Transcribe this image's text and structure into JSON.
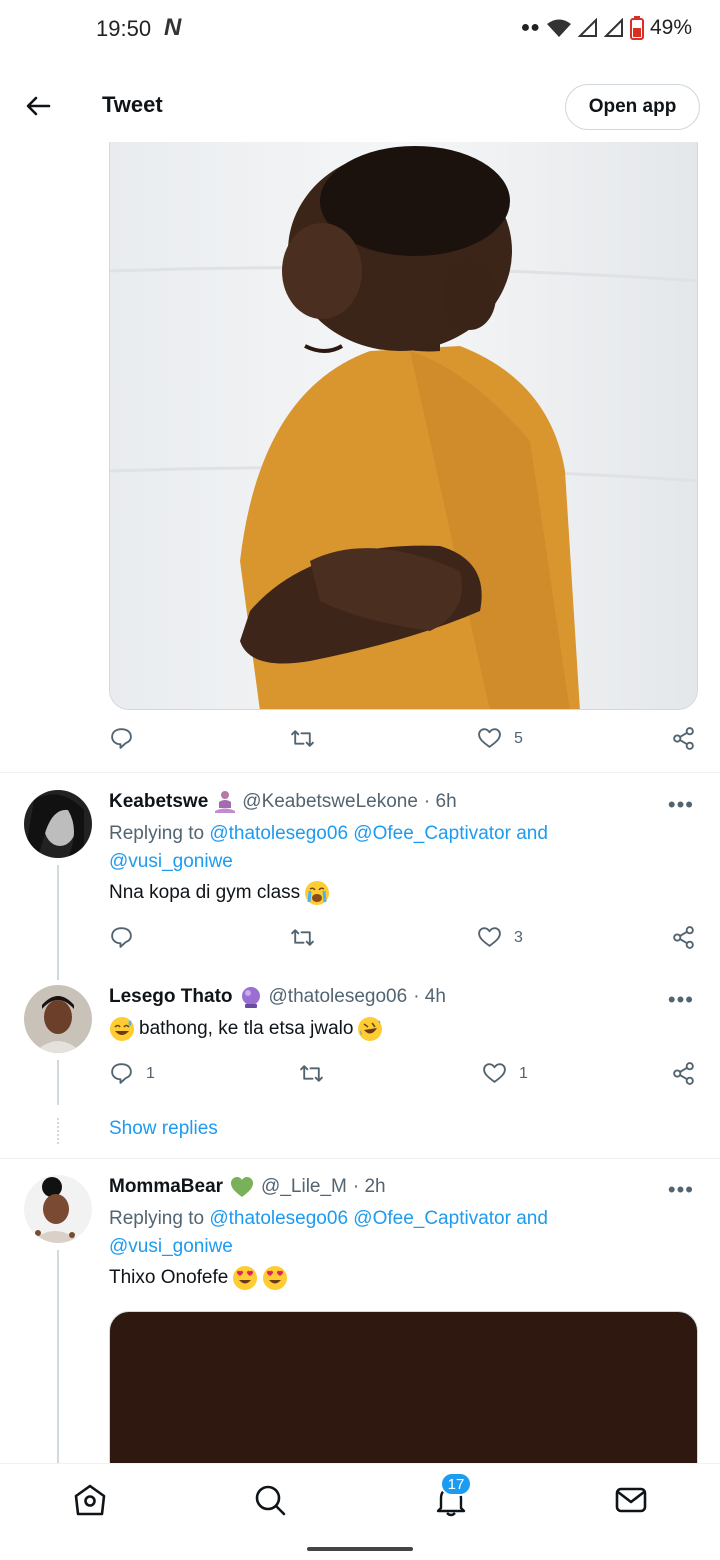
{
  "status": {
    "time": "19:50",
    "battery": "49%"
  },
  "header": {
    "title": "Tweet",
    "open_app": "Open app"
  },
  "main_tweet": {
    "likes": "5"
  },
  "replies": [
    {
      "name": "Keabetswe",
      "handle": "@KeabetsweLekone",
      "time": "· 6h",
      "replying_prefix": "Replying to",
      "mentions_line1": "@thatolesego06 @Ofee_Captivator",
      "and": "and",
      "mentions_line2": "@vusi_goniwe",
      "text": "Nna kopa di gym class",
      "likes": "3"
    },
    {
      "name": "Lesego Thato",
      "handle": "@thatolesego06",
      "time": "· 4h",
      "text": "bathong, ke tla etsa jwalo",
      "replies": "1",
      "likes": "1",
      "show_replies": "Show replies"
    },
    {
      "name": "MommaBear",
      "handle": "@_Lile_M",
      "time": "· 2h",
      "replying_prefix": "Replying to",
      "mentions_line1": "@thatolesego06 @Ofee_Captivator",
      "and": "and",
      "mentions_line2": "@vusi_goniwe",
      "text": "Thixo Onofefe"
    }
  ],
  "nav": {
    "notifications_badge": "17"
  },
  "colors": {
    "accent": "#1d9bf0",
    "muted": "#536471",
    "text": "#0f1419"
  }
}
